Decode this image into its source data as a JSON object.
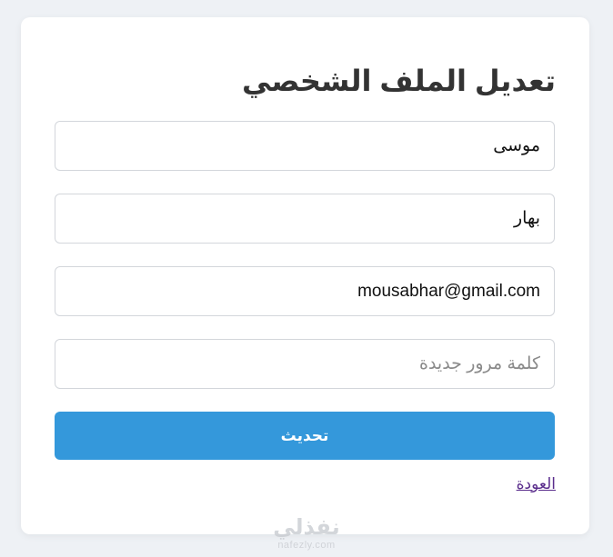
{
  "profile_form": {
    "title": "تعديل الملف الشخصي",
    "first_name_value": "موسى",
    "last_name_value": "بهار",
    "email_value": "mousabhar@gmail.com",
    "password_placeholder": "كلمة مرور جديدة",
    "password_value": "",
    "submit_label": "تحديث",
    "back_link": "العودة"
  },
  "watermark": {
    "arabic": "نفذلي",
    "latin": "nafezly.com"
  },
  "colors": {
    "background": "#eef1f5",
    "card": "#ffffff",
    "primary_button": "#3498db",
    "link": "#5a2d8c",
    "title": "#333333"
  }
}
